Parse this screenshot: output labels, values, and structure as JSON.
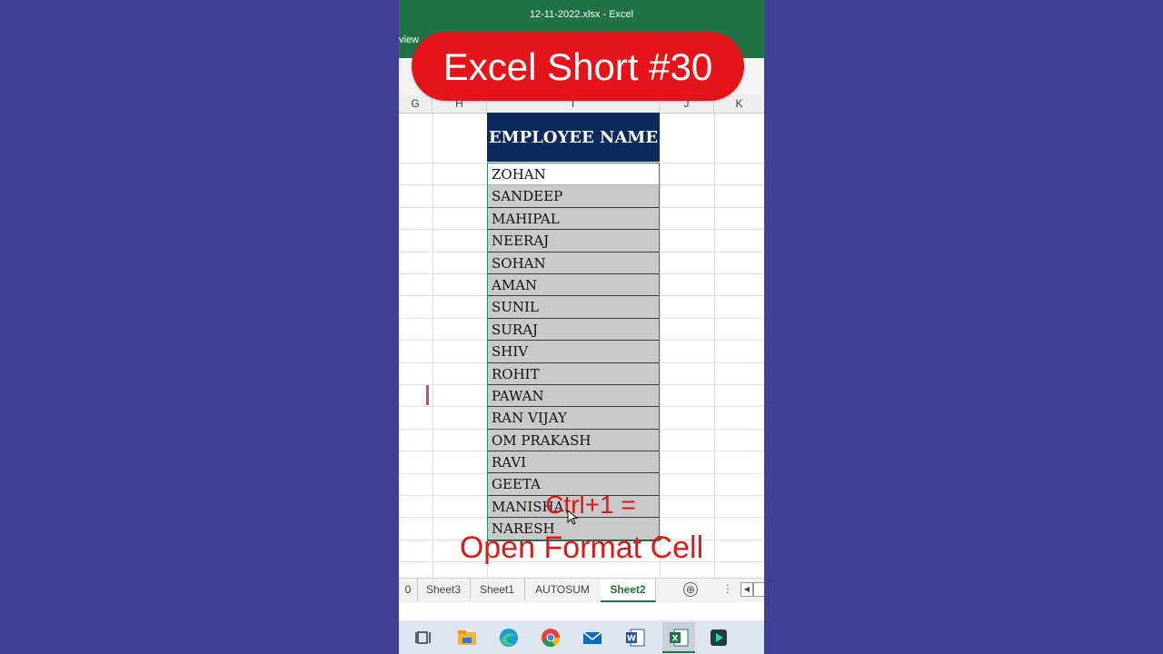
{
  "window": {
    "title": "12-11-2022.xlsx - Excel",
    "ribbon_tab_fragment": "view"
  },
  "overlay": {
    "badge": "Excel Short #30",
    "line1": "Ctrl+1 =",
    "line2": "Open Format Cell"
  },
  "columns": [
    "G",
    "H",
    "I",
    "J",
    "K"
  ],
  "header": {
    "employee_name": "EMPLOYEE NAME"
  },
  "employees": [
    "ZOHAN",
    "SANDEEP",
    "MAHIPAL",
    "NEERAJ",
    "SOHAN",
    "AMAN",
    "SUNIL",
    "SURAJ",
    "SHIV",
    "ROHIT",
    "PAWAN",
    "RAN VIJAY",
    "OM PRAKASH",
    "RAVI",
    "GEETA",
    "MANISHA",
    "NARESH"
  ],
  "sheets": {
    "partial": "0",
    "tabs": [
      "Sheet3",
      "Sheet1",
      "AUTOSUM",
      "Sheet2"
    ],
    "active": "Sheet2"
  },
  "sheet_controls": {
    "add": "⊕",
    "menu": "⋮",
    "scroll_left": "◀"
  },
  "taskbar": {
    "icons": [
      "task-view-icon",
      "file-explorer-icon",
      "edge-icon",
      "chrome-icon",
      "mail-icon",
      "word-icon",
      "excel-icon",
      "media-player-icon"
    ]
  },
  "colors": {
    "excel_green": "#217346",
    "header_navy": "#0e2a5c",
    "accent_red": "#e4141a",
    "background": "#413f96"
  }
}
